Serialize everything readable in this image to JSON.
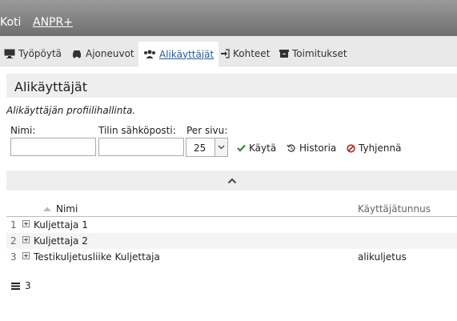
{
  "topbar": {
    "home": "Koti",
    "app": "ANPR+"
  },
  "tabs": [
    {
      "label": "Työpöytä"
    },
    {
      "label": "Ajoneuvot"
    },
    {
      "label": "Alikäyttäjät"
    },
    {
      "label": "Kohteet"
    },
    {
      "label": "Toimitukset"
    }
  ],
  "page": {
    "title": "Alikäyttäjät",
    "subtitle": "Alikäyttäjän profiilihallinta."
  },
  "filters": {
    "name_label": "Nimi:",
    "email_label": "Tilin sähköposti:",
    "per_page_label": "Per sivu:",
    "per_page_value": "25",
    "apply": "Käytä",
    "history": "Historia",
    "clear": "Tyhjennä"
  },
  "table": {
    "columns": [
      "Nimi",
      "Käyttäjätunnus"
    ],
    "rows": [
      {
        "num": "1",
        "name": "Kuljettaja 1",
        "username": ""
      },
      {
        "num": "2",
        "name": "Kuljettaja 2",
        "username": ""
      },
      {
        "num": "3",
        "name": "Testikuljetusliike Kuljettaja",
        "username": "alikuljetus"
      }
    ]
  },
  "footer": {
    "count": "3"
  },
  "colors": {
    "accent_blue": "#2b5c99",
    "apply_green": "#2e8b2e",
    "clear_red": "#b22222"
  }
}
